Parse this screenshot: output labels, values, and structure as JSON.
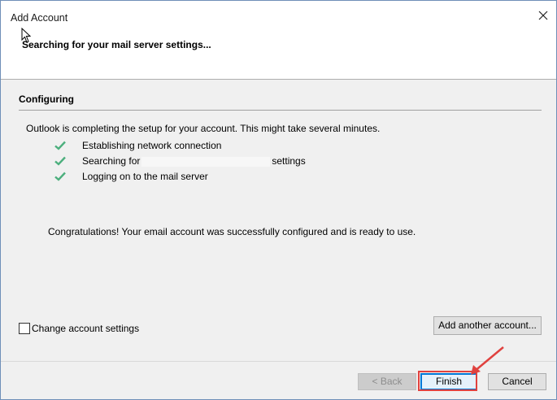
{
  "window": {
    "title": "Add Account",
    "close_icon": "close-icon"
  },
  "header": {
    "title": "Searching for your mail server settings..."
  },
  "section": {
    "title": "Configuring",
    "description": "Outlook is completing the setup for your account. This might take several minutes."
  },
  "steps": [
    {
      "label": "Establishing network connection",
      "icon": "checkmark-icon"
    },
    {
      "label_before": "Searching for",
      "label_after": "settings",
      "icon": "checkmark-icon"
    },
    {
      "label": "Logging on to the mail server",
      "icon": "checkmark-icon"
    }
  ],
  "congrats": "Congratulations! Your email account was successfully configured and is ready to use.",
  "change_settings": {
    "label": "Change account settings",
    "checked": false
  },
  "buttons": {
    "add_another": "Add another account...",
    "back": "< Back",
    "finish": "Finish",
    "cancel": "Cancel"
  },
  "colors": {
    "check_green": "#4caf7d",
    "annotation_red": "#e0423f",
    "focus_blue": "#0078d7"
  }
}
